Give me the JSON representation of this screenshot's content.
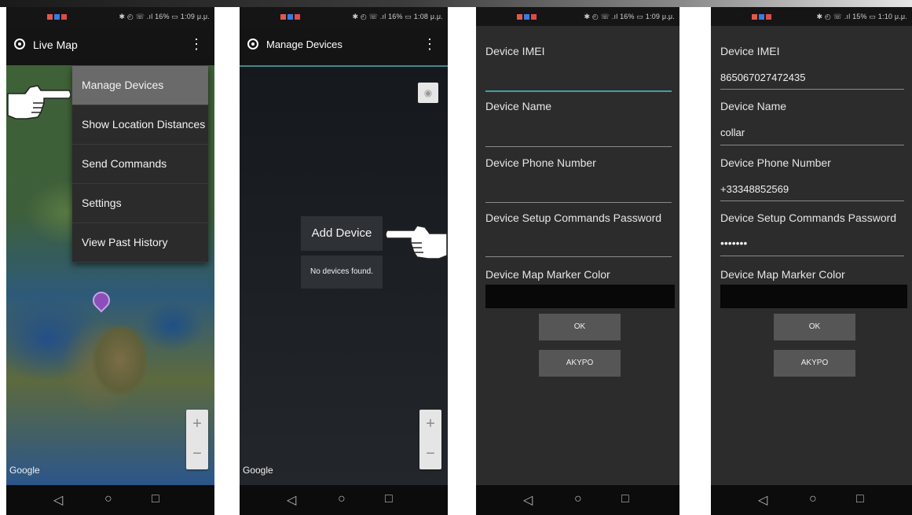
{
  "status_bar": {
    "p1": "✱ ◴ ☏ .ıl 16% ▭ 1:09 μ.μ.",
    "p2": "✱ ◴ ☏ .ıl 16% ▭ 1:08 μ.μ.",
    "p3": "✱ ◴ ☏ .ıl 16% ▭ 1:09 μ.μ.",
    "p4": "✱ ◴ ☏ .ıl 15% ▭ 1:10 μ.μ."
  },
  "navbar": {
    "back": "◁",
    "home": "○",
    "recent": "□"
  },
  "live_map": {
    "title": "Live Map",
    "menu": [
      "Manage Devices",
      "Show Location Distances",
      "Send Commands",
      "Settings",
      "View Past History"
    ],
    "zoom_in": "+",
    "zoom_out": "−",
    "google": "Google"
  },
  "manage_devices": {
    "title": "Manage Devices",
    "add_device": "Add Device",
    "empty": "No devices found.",
    "zoom_in": "+",
    "zoom_out": "−",
    "google": "Google"
  },
  "form_labels": {
    "imei": "Device IMEI",
    "name": "Device Name",
    "phone": "Device Phone Number",
    "password": "Device Setup Commands Password",
    "color": "Device Map Marker Color"
  },
  "form_filled": {
    "imei": "865067027472435",
    "name": "collar",
    "phone": "+33348852569",
    "password": "•••••••"
  },
  "buttons": {
    "ok": "OK",
    "cancel": "AKYPO"
  },
  "colors": {
    "accent": "#3fa0a0",
    "marker": "#8a4fb8",
    "menu_highlight": "#6a6a6a"
  }
}
